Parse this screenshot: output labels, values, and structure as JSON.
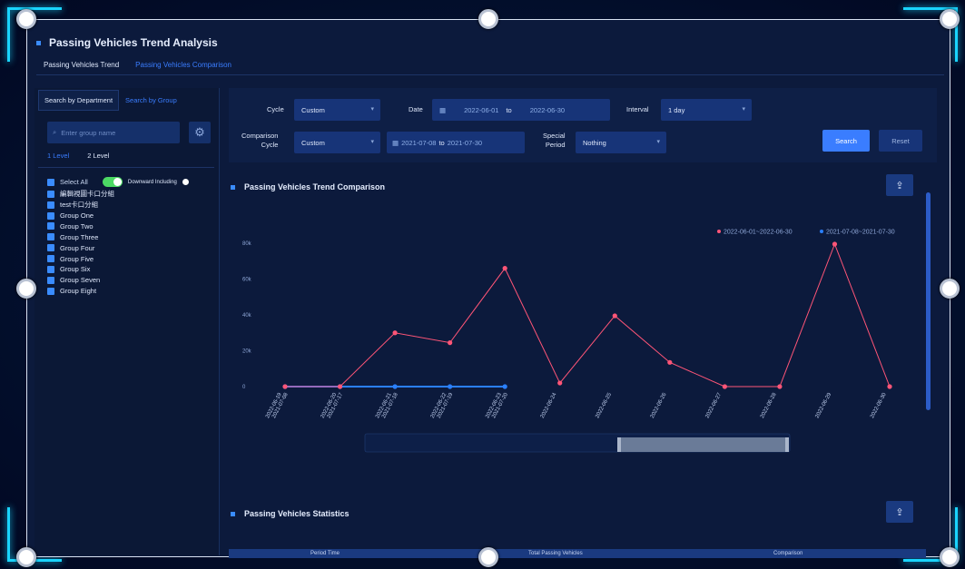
{
  "header": {
    "title": "Passing Vehicles Trend Analysis"
  },
  "tabs": [
    {
      "label": "Passing Vehicles Trend",
      "active": false
    },
    {
      "label": "Passing Vehicles Comparison",
      "active": true
    }
  ],
  "left_panel": {
    "subtabs": [
      {
        "label": "Search by Department",
        "active": false
      },
      {
        "label": "Search by Group",
        "active": true
      }
    ],
    "search_placeholder": "Enter group name",
    "levels": [
      {
        "label": "1 Level",
        "active": true
      },
      {
        "label": "2 Level",
        "active": false
      }
    ],
    "select_all": "Select All",
    "downward_including": "Downward Including",
    "groups": [
      "編輯視圖卡口分組",
      "test卡口分組",
      "Group One",
      "Group Two",
      "Group Three",
      "Group Four",
      "Group Five",
      "Group Six",
      "Group Seven",
      "Group Eight"
    ]
  },
  "filters": {
    "cycle_label": "Cycle",
    "cycle_value": "Custom",
    "date_label": "Date",
    "date_start": "2022-06-01",
    "date_to": "to",
    "date_end": "2022-06-30",
    "interval_label": "Interval",
    "interval_value": "1 day",
    "comparison_label_1": "Comparison",
    "comparison_label_2": "Cycle",
    "comparison_value": "Custom",
    "comparison_start": "2021-07-08",
    "comparison_end": "2021-07-30",
    "special_label_1": "Special",
    "special_label_2": "Period",
    "special_value": "Nothing",
    "search_label": "Search",
    "reset_label": "Reset"
  },
  "trend_section": {
    "title": "Passing Vehicles Trend Comparison"
  },
  "stats_section": {
    "title": "Passing Vehicles Statistics",
    "columns": [
      "Period Time",
      "Total Passing Vehicles",
      "Comparison"
    ]
  },
  "colors": {
    "series1": "#ff5577",
    "series2": "#2a7fff",
    "accent": "#3a7dff"
  },
  "chart_data": {
    "type": "line",
    "title": "Passing Vehicles Trend Comparison",
    "xlabel": "",
    "ylabel": "",
    "ylim": [
      0,
      80
    ],
    "yticks": [
      "0",
      "20k",
      "40k",
      "60k",
      "80k"
    ],
    "legend_position": "top-right",
    "categories": [
      [
        "2022-06-19",
        "2021-07-08"
      ],
      [
        "2022-06-20",
        "2021-07-17"
      ],
      [
        "2022-06-21",
        "2021-07-18"
      ],
      [
        "2022-06-22",
        "2021-07-19"
      ],
      [
        "2022-06-23",
        "2021-07-20"
      ],
      [
        "2022-06-24"
      ],
      [
        "2022-06-25"
      ],
      [
        "2022-06-26"
      ],
      [
        "2022-06-27"
      ],
      [
        "2022-06-28"
      ],
      [
        "2022-06-29"
      ],
      [
        "2022-06-30"
      ]
    ],
    "series": [
      {
        "name": "2022-06-01~2022-06-30",
        "values": [
          0,
          0,
          30,
          24.5,
          66,
          2,
          39.5,
          13.5,
          0,
          0,
          79.5,
          0
        ]
      },
      {
        "name": "2021-07-08~2021-07-30",
        "values": [
          0,
          0,
          0,
          0,
          0,
          null,
          null,
          null,
          null,
          null,
          null,
          null
        ]
      }
    ]
  }
}
